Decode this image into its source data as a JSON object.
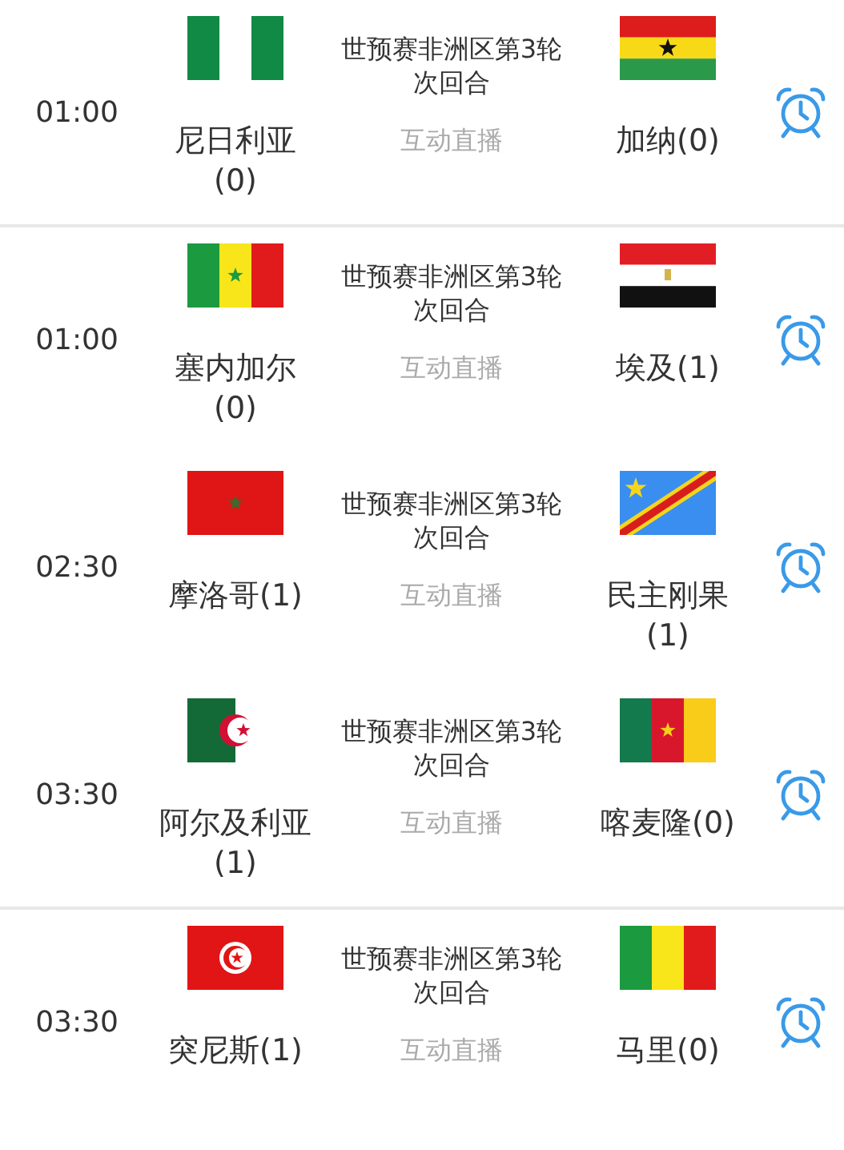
{
  "matches": [
    {
      "time": "01:00",
      "home": {
        "kind": "nigeria",
        "name": "尼日利亚(0)"
      },
      "round": "世预赛非洲区第3轮次回合",
      "live": "互动直播",
      "away": {
        "kind": "ghana",
        "name": "加纳(0)"
      },
      "divider_below": true
    },
    {
      "time": "01:00",
      "home": {
        "kind": "senegal",
        "name": "塞内加尔(0)"
      },
      "round": "世预赛非洲区第3轮次回合",
      "live": "互动直播",
      "away": {
        "kind": "egypt",
        "name": "埃及(1)"
      },
      "divider_below": false
    },
    {
      "time": "02:30",
      "home": {
        "kind": "morocco",
        "name": "摩洛哥(1)"
      },
      "round": "世预赛非洲区第3轮次回合",
      "live": "互动直播",
      "away": {
        "kind": "drcongo",
        "name": "民主刚果(1)"
      },
      "divider_below": false
    },
    {
      "time": "03:30",
      "home": {
        "kind": "algeria",
        "name": "阿尔及利亚(1)"
      },
      "round": "世预赛非洲区第3轮次回合",
      "live": "互动直播",
      "away": {
        "kind": "cameroon",
        "name": "喀麦隆(0)"
      },
      "divider_below": true
    },
    {
      "time": "03:30",
      "home": {
        "kind": "tunisia",
        "name": "突尼斯(1)"
      },
      "round": "世预赛非洲区第3轮次回合",
      "live": "互动直播",
      "away": {
        "kind": "mali",
        "name": "马里(0)"
      },
      "divider_below": false
    }
  ]
}
